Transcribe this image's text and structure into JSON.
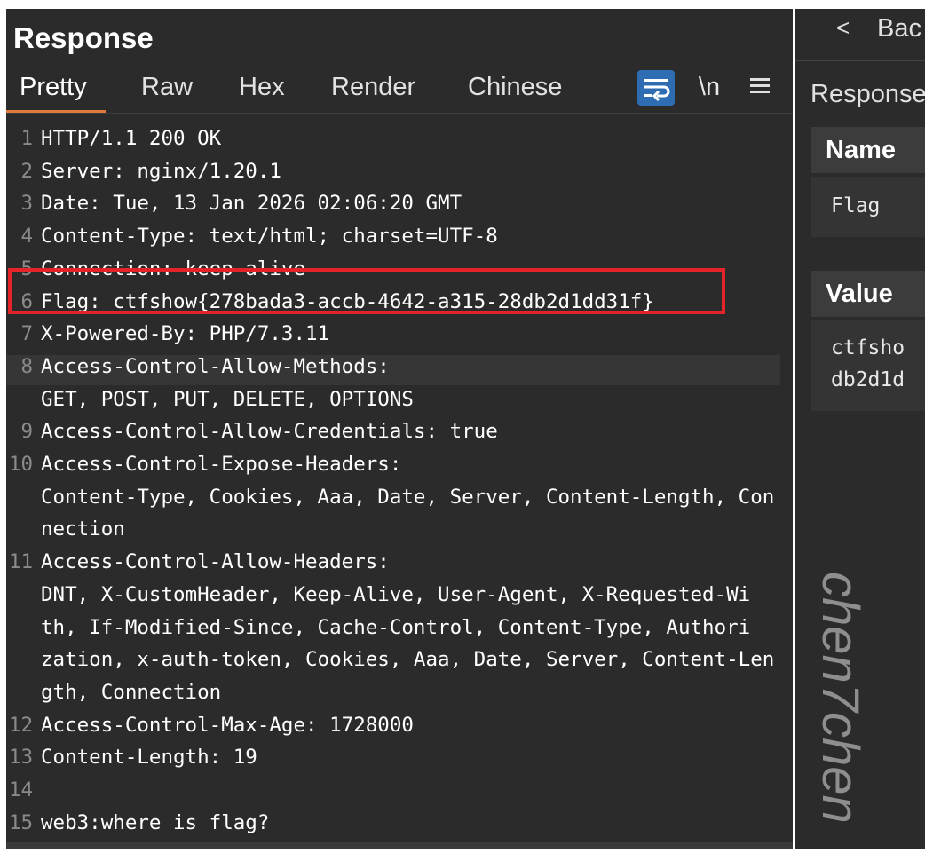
{
  "response_panel": {
    "title": "Response",
    "tabs": [
      "Pretty",
      "Raw",
      "Hex",
      "Render",
      "Chinese"
    ],
    "active_tab": "Pretty",
    "newline_toggle_label": "\\n"
  },
  "lines": [
    {
      "n": "1",
      "rows": [
        "HTTP/1.1 200 OK"
      ]
    },
    {
      "n": "2",
      "rows": [
        "Server: nginx/1.20.1"
      ]
    },
    {
      "n": "3",
      "rows": [
        "Date: Tue, 13 Jan 2026 02:06:20 GMT"
      ]
    },
    {
      "n": "4",
      "rows": [
        "Content-Type: text/html; charset=UTF-8"
      ]
    },
    {
      "n": "5",
      "rows": [
        "Connection: keep-alive"
      ]
    },
    {
      "n": "6",
      "rows": [
        "Flag: ctfshow{278bada3-accb-4642-a315-28db2d1dd31f}"
      ]
    },
    {
      "n": "7",
      "rows": [
        "X-Powered-By: PHP/7.3.11"
      ]
    },
    {
      "n": "8",
      "rows": [
        "Access-Control-Allow-Methods:",
        "GET, POST, PUT, DELETE, OPTIONS"
      ]
    },
    {
      "n": "9",
      "rows": [
        "Access-Control-Allow-Credentials: true"
      ]
    },
    {
      "n": "10",
      "rows": [
        "Access-Control-Expose-Headers:",
        "Content-Type, Cookies, Aaa, Date, Server, Content-Length, Con",
        "nection"
      ]
    },
    {
      "n": "11",
      "rows": [
        "Access-Control-Allow-Headers:",
        "DNT, X-CustomHeader, Keep-Alive, User-Agent, X-Requested-Wi",
        "th, If-Modified-Since, Cache-Control, Content-Type, Authori",
        "zation, x-auth-token, Cookies, Aaa, Date, Server, Content-Len",
        "gth, Connection"
      ]
    },
    {
      "n": "12",
      "rows": [
        "Access-Control-Max-Age: 1728000"
      ]
    },
    {
      "n": "13",
      "rows": [
        "Content-Length: 19"
      ]
    },
    {
      "n": "14",
      "rows": [
        ""
      ]
    },
    {
      "n": "15",
      "rows": [
        "web3:where is flag?"
      ]
    }
  ],
  "inspector": {
    "back_label": "Bac",
    "title": "Response",
    "name_header": "Name",
    "name_value": "Flag",
    "value_header": "Value",
    "value_lines": [
      "ctfsho",
      "db2d1d"
    ]
  },
  "watermark": "chen7chen",
  "colors": {
    "panel_bg": "#2b2b2b",
    "active_tab_underline": "#e07a3c",
    "wrap_button": "#2f6db3",
    "highlight_box": "#e3242b"
  }
}
